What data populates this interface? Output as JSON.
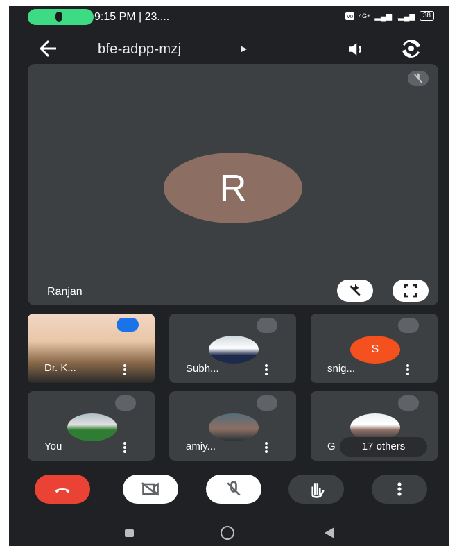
{
  "status_bar": {
    "time_text": "9:15 PM | 23....",
    "network_text": "4G+",
    "battery_text": "38"
  },
  "app_bar": {
    "meeting_code": "bfe-adpp-mzj"
  },
  "main_tile": {
    "participant_name": "Ranjan",
    "avatar_letter": "R",
    "avatar_color": "#8d6e63"
  },
  "tiles": [
    {
      "name": "Dr. K..."
    },
    {
      "name": "Subh..."
    },
    {
      "name": "snig...",
      "avatar_letter": "S",
      "avatar_color": "#f4511e"
    },
    {
      "name": "You"
    },
    {
      "name": "amiy..."
    },
    {
      "name": "G",
      "others_label": "17 others"
    }
  ],
  "colors": {
    "end_call": "#ea4335",
    "screen_bg": "#202124",
    "tile_bg": "#3c4043"
  }
}
